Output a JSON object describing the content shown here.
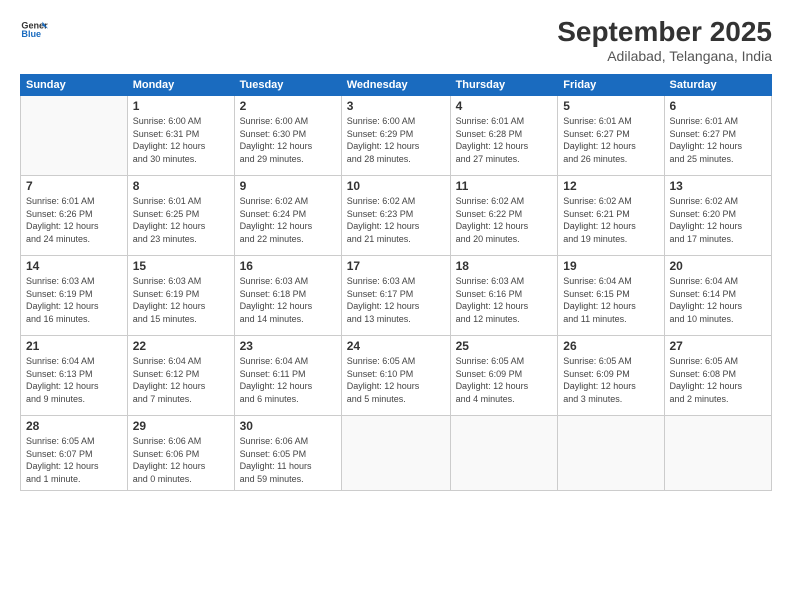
{
  "logo": {
    "line1": "General",
    "line2": "Blue"
  },
  "title": "September 2025",
  "subtitle": "Adilabad, Telangana, India",
  "days_header": [
    "Sunday",
    "Monday",
    "Tuesday",
    "Wednesday",
    "Thursday",
    "Friday",
    "Saturday"
  ],
  "weeks": [
    [
      {
        "day": "",
        "info": ""
      },
      {
        "day": "1",
        "info": "Sunrise: 6:00 AM\nSunset: 6:31 PM\nDaylight: 12 hours\nand 30 minutes."
      },
      {
        "day": "2",
        "info": "Sunrise: 6:00 AM\nSunset: 6:30 PM\nDaylight: 12 hours\nand 29 minutes."
      },
      {
        "day": "3",
        "info": "Sunrise: 6:00 AM\nSunset: 6:29 PM\nDaylight: 12 hours\nand 28 minutes."
      },
      {
        "day": "4",
        "info": "Sunrise: 6:01 AM\nSunset: 6:28 PM\nDaylight: 12 hours\nand 27 minutes."
      },
      {
        "day": "5",
        "info": "Sunrise: 6:01 AM\nSunset: 6:27 PM\nDaylight: 12 hours\nand 26 minutes."
      },
      {
        "day": "6",
        "info": "Sunrise: 6:01 AM\nSunset: 6:27 PM\nDaylight: 12 hours\nand 25 minutes."
      }
    ],
    [
      {
        "day": "7",
        "info": "Sunrise: 6:01 AM\nSunset: 6:26 PM\nDaylight: 12 hours\nand 24 minutes."
      },
      {
        "day": "8",
        "info": "Sunrise: 6:01 AM\nSunset: 6:25 PM\nDaylight: 12 hours\nand 23 minutes."
      },
      {
        "day": "9",
        "info": "Sunrise: 6:02 AM\nSunset: 6:24 PM\nDaylight: 12 hours\nand 22 minutes."
      },
      {
        "day": "10",
        "info": "Sunrise: 6:02 AM\nSunset: 6:23 PM\nDaylight: 12 hours\nand 21 minutes."
      },
      {
        "day": "11",
        "info": "Sunrise: 6:02 AM\nSunset: 6:22 PM\nDaylight: 12 hours\nand 20 minutes."
      },
      {
        "day": "12",
        "info": "Sunrise: 6:02 AM\nSunset: 6:21 PM\nDaylight: 12 hours\nand 19 minutes."
      },
      {
        "day": "13",
        "info": "Sunrise: 6:02 AM\nSunset: 6:20 PM\nDaylight: 12 hours\nand 17 minutes."
      }
    ],
    [
      {
        "day": "14",
        "info": "Sunrise: 6:03 AM\nSunset: 6:19 PM\nDaylight: 12 hours\nand 16 minutes."
      },
      {
        "day": "15",
        "info": "Sunrise: 6:03 AM\nSunset: 6:19 PM\nDaylight: 12 hours\nand 15 minutes."
      },
      {
        "day": "16",
        "info": "Sunrise: 6:03 AM\nSunset: 6:18 PM\nDaylight: 12 hours\nand 14 minutes."
      },
      {
        "day": "17",
        "info": "Sunrise: 6:03 AM\nSunset: 6:17 PM\nDaylight: 12 hours\nand 13 minutes."
      },
      {
        "day": "18",
        "info": "Sunrise: 6:03 AM\nSunset: 6:16 PM\nDaylight: 12 hours\nand 12 minutes."
      },
      {
        "day": "19",
        "info": "Sunrise: 6:04 AM\nSunset: 6:15 PM\nDaylight: 12 hours\nand 11 minutes."
      },
      {
        "day": "20",
        "info": "Sunrise: 6:04 AM\nSunset: 6:14 PM\nDaylight: 12 hours\nand 10 minutes."
      }
    ],
    [
      {
        "day": "21",
        "info": "Sunrise: 6:04 AM\nSunset: 6:13 PM\nDaylight: 12 hours\nand 9 minutes."
      },
      {
        "day": "22",
        "info": "Sunrise: 6:04 AM\nSunset: 6:12 PM\nDaylight: 12 hours\nand 7 minutes."
      },
      {
        "day": "23",
        "info": "Sunrise: 6:04 AM\nSunset: 6:11 PM\nDaylight: 12 hours\nand 6 minutes."
      },
      {
        "day": "24",
        "info": "Sunrise: 6:05 AM\nSunset: 6:10 PM\nDaylight: 12 hours\nand 5 minutes."
      },
      {
        "day": "25",
        "info": "Sunrise: 6:05 AM\nSunset: 6:09 PM\nDaylight: 12 hours\nand 4 minutes."
      },
      {
        "day": "26",
        "info": "Sunrise: 6:05 AM\nSunset: 6:09 PM\nDaylight: 12 hours\nand 3 minutes."
      },
      {
        "day": "27",
        "info": "Sunrise: 6:05 AM\nSunset: 6:08 PM\nDaylight: 12 hours\nand 2 minutes."
      }
    ],
    [
      {
        "day": "28",
        "info": "Sunrise: 6:05 AM\nSunset: 6:07 PM\nDaylight: 12 hours\nand 1 minute."
      },
      {
        "day": "29",
        "info": "Sunrise: 6:06 AM\nSunset: 6:06 PM\nDaylight: 12 hours\nand 0 minutes."
      },
      {
        "day": "30",
        "info": "Sunrise: 6:06 AM\nSunset: 6:05 PM\nDaylight: 11 hours\nand 59 minutes."
      },
      {
        "day": "",
        "info": ""
      },
      {
        "day": "",
        "info": ""
      },
      {
        "day": "",
        "info": ""
      },
      {
        "day": "",
        "info": ""
      }
    ]
  ]
}
